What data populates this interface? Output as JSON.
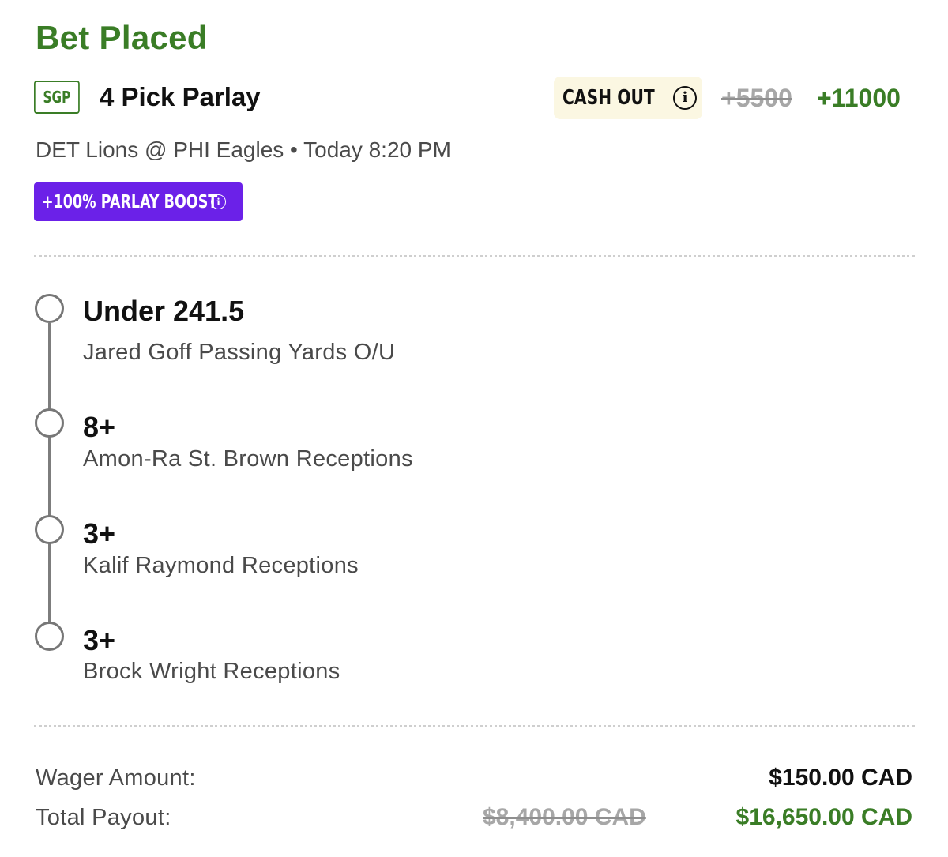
{
  "header": {
    "title": "Bet Placed",
    "badge": "SGP",
    "bet_type": "4 Pick Parlay",
    "cash_out_label": "CASH OUT",
    "old_odds": "+5500",
    "new_odds": "+11000",
    "matchup": "DET Lions @ PHI Eagles • Today 8:20 PM",
    "boost_label": "+100% PARLAY BOOST"
  },
  "legs": [
    {
      "pick": "Under 241.5",
      "market": "Jared Goff Passing Yards O/U"
    },
    {
      "pick": "8+",
      "market": "Amon-Ra St. Brown Receptions"
    },
    {
      "pick": "3+",
      "market": "Kalif Raymond Receptions"
    },
    {
      "pick": "3+",
      "market": "Brock Wright Receptions"
    }
  ],
  "summary": {
    "wager_label": "Wager Amount:",
    "wager_value": "$150.00 CAD",
    "payout_label": "Total Payout:",
    "payout_old": "$8,400.00 CAD",
    "payout_new": "$16,650.00 CAD"
  },
  "icons": {
    "info": "info-circle-icon",
    "timeline": "radio-circle-icon"
  },
  "colors": {
    "accent_green": "#3a7d26",
    "boost_purple": "#6b21e8",
    "cashout_bg": "#fbf7e2",
    "muted_gray": "#a7a7a7"
  }
}
